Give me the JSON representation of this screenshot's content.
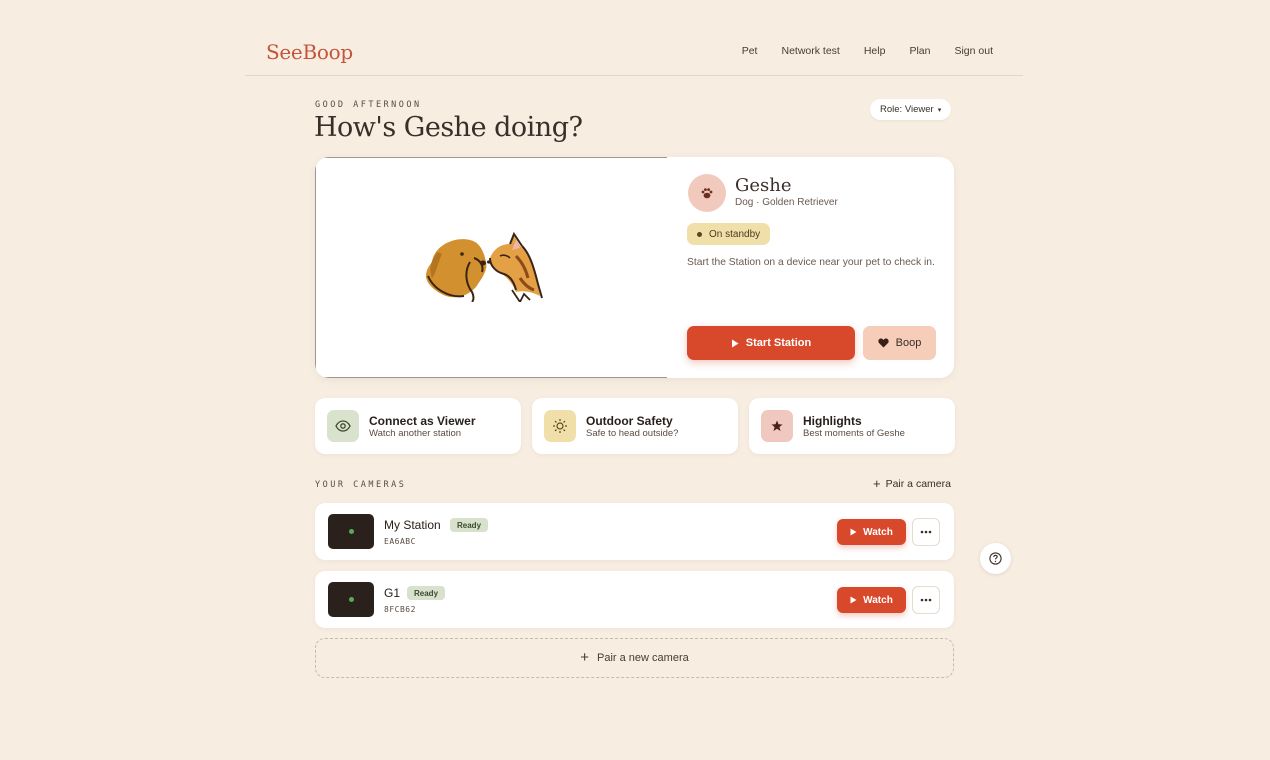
{
  "app": {
    "logo": "SeeBoop"
  },
  "nav": {
    "items": [
      "Pet",
      "Network test",
      "Help",
      "Plan",
      "Sign out"
    ]
  },
  "greeting": {
    "eyebrow": "GOOD AFTERNOON",
    "title": "How's Geshe doing?"
  },
  "role": {
    "label": "Role: Viewer",
    "caret": "▾"
  },
  "pet": {
    "name": "Geshe",
    "subtitle": "Dog · Golden Retriever",
    "status": "On standby",
    "description": "Start the Station on a device near your pet to check in.",
    "start_label": "Start Station",
    "boop_label": "Boop"
  },
  "quick_actions": [
    {
      "title": "Connect as Viewer",
      "subtitle": "Watch another station",
      "icon": "eye-icon",
      "bg": "#d9e2cc"
    },
    {
      "title": "Outdoor Safety",
      "subtitle": "Safe to head outside?",
      "icon": "sun-icon",
      "bg": "#f1dfaa"
    },
    {
      "title": "Highlights",
      "subtitle": "Best moments of Geshe",
      "icon": "star-icon",
      "bg": "#f0c8bf"
    }
  ],
  "cameras": {
    "eyebrow": "YOUR CAMERAS",
    "pair_label": "Pair a camera",
    "items": [
      {
        "name": "My Station",
        "status": "Ready",
        "id": "EA6ABC",
        "watch_label": "Watch"
      },
      {
        "name": "G1",
        "status": "Ready",
        "id": "8FCB62",
        "watch_label": "Watch"
      }
    ],
    "pair_new_label": "Pair a new camera"
  },
  "colors": {
    "background": "#f7ede1",
    "accent": "#d8492b",
    "brand": "#c4543a",
    "standby": "#f1dfaa",
    "ready": "#d7e1cc"
  }
}
